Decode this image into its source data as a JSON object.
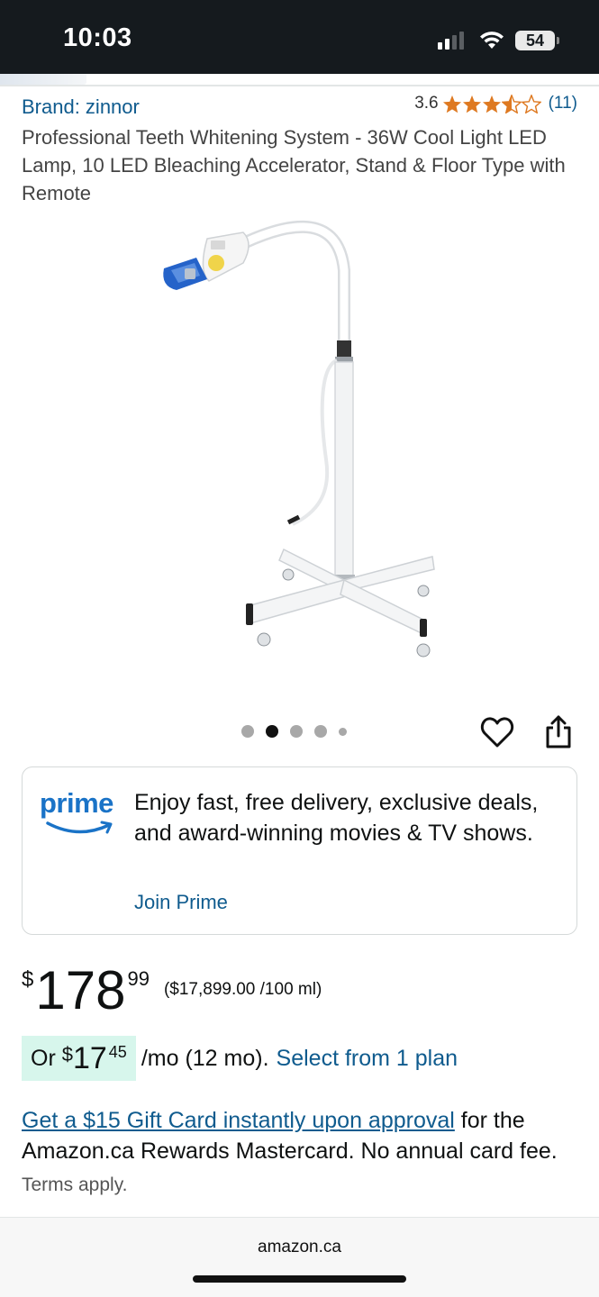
{
  "status_bar": {
    "time": "10:03",
    "battery": "54",
    "icons": [
      "cellular-signal-icon",
      "wifi-icon",
      "battery-icon"
    ]
  },
  "product": {
    "brand_label": "Brand: zinnor",
    "rating_value": "3.6",
    "rating_stars": 3.5,
    "rating_count": "(11)",
    "title": "Professional Teeth Whitening System - 36W Cool Light LED Lamp, 10 LED Bleaching Accelerator, Stand & Floor Type with Remote",
    "image_icon": "led-lamp-on-stand",
    "carousel": {
      "count": 5,
      "active_index": 1
    }
  },
  "actions": {
    "heart_icon": "heart-icon",
    "share_icon": "share-icon"
  },
  "prime": {
    "logo_text": "prime",
    "message": "Enjoy fast, free delivery, exclusive deals, and award-winning movies & TV shows.",
    "link": "Join Prime",
    "brand_color": "#1a73c7"
  },
  "price": {
    "symbol": "$",
    "whole": "178",
    "fraction": "99",
    "unit_price": "($17,899.00 /100 ml)"
  },
  "monthly": {
    "prefix": "Or ",
    "symbol": "$",
    "whole": "17",
    "fraction": "45",
    "term": "/mo (12 mo).",
    "link": "Select from 1 plan",
    "highlight_color": "#d7f6ec"
  },
  "gift": {
    "link": "Get a $15 Gift Card instantly upon approval",
    "text": " for the Amazon.ca Rewards Mastercard. No annual card fee.",
    "terms": " Terms apply."
  },
  "footer": {
    "url": "amazon.ca"
  },
  "colors": {
    "link": "#0f5b8e",
    "star": "#de7921",
    "status_bg": "#151a1e"
  }
}
